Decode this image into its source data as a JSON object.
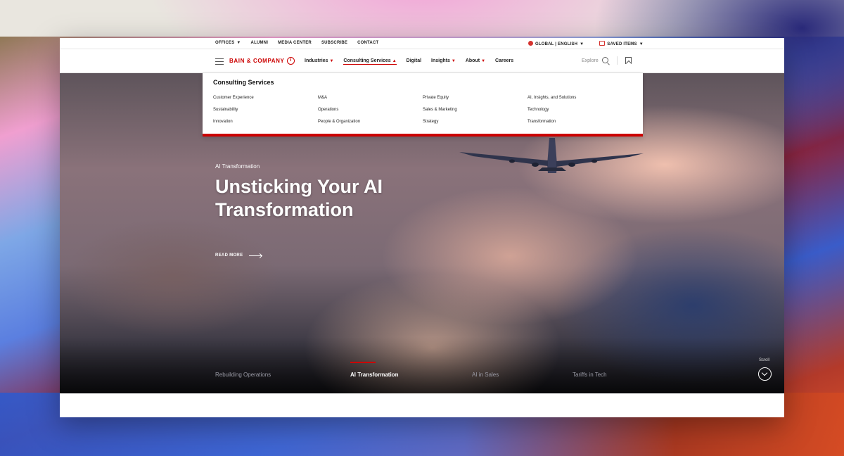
{
  "utility": {
    "left_items": [
      "OFFICES",
      "ALUMNI",
      "MEDIA CENTER",
      "SUBSCRIBE",
      "CONTACT"
    ],
    "language": "GLOBAL | ENGLISH",
    "saved": "SAVED ITEMS"
  },
  "nav": {
    "logo": "BAIN & COMPANY",
    "items": [
      "Industries",
      "Consulting Services",
      "Digital",
      "Insights",
      "About",
      "Careers"
    ],
    "explore": "Explore"
  },
  "dropdown": {
    "title": "Consulting Services",
    "columns": [
      [
        "Customer Experience",
        "Sustainability",
        "Innovation"
      ],
      [
        "M&A",
        "Operations",
        "People & Organization"
      ],
      [
        "Private Equity",
        "Sales & Marketing",
        "Strategy"
      ],
      [
        "AI, Insights, and Solutions",
        "Technology",
        "Transformation"
      ]
    ]
  },
  "hero": {
    "eyebrow": "AI Transformation",
    "headline": "Unsticking Your AI Transformation",
    "read_more": "READ MORE"
  },
  "tabs": [
    "Rebuilding Operations",
    "AI Transformation",
    "AI in Sales",
    "Tariffs in Tech"
  ],
  "active_tab": 1,
  "scroll_label": "Scroll",
  "colors": {
    "brand_red": "#cc0000"
  }
}
